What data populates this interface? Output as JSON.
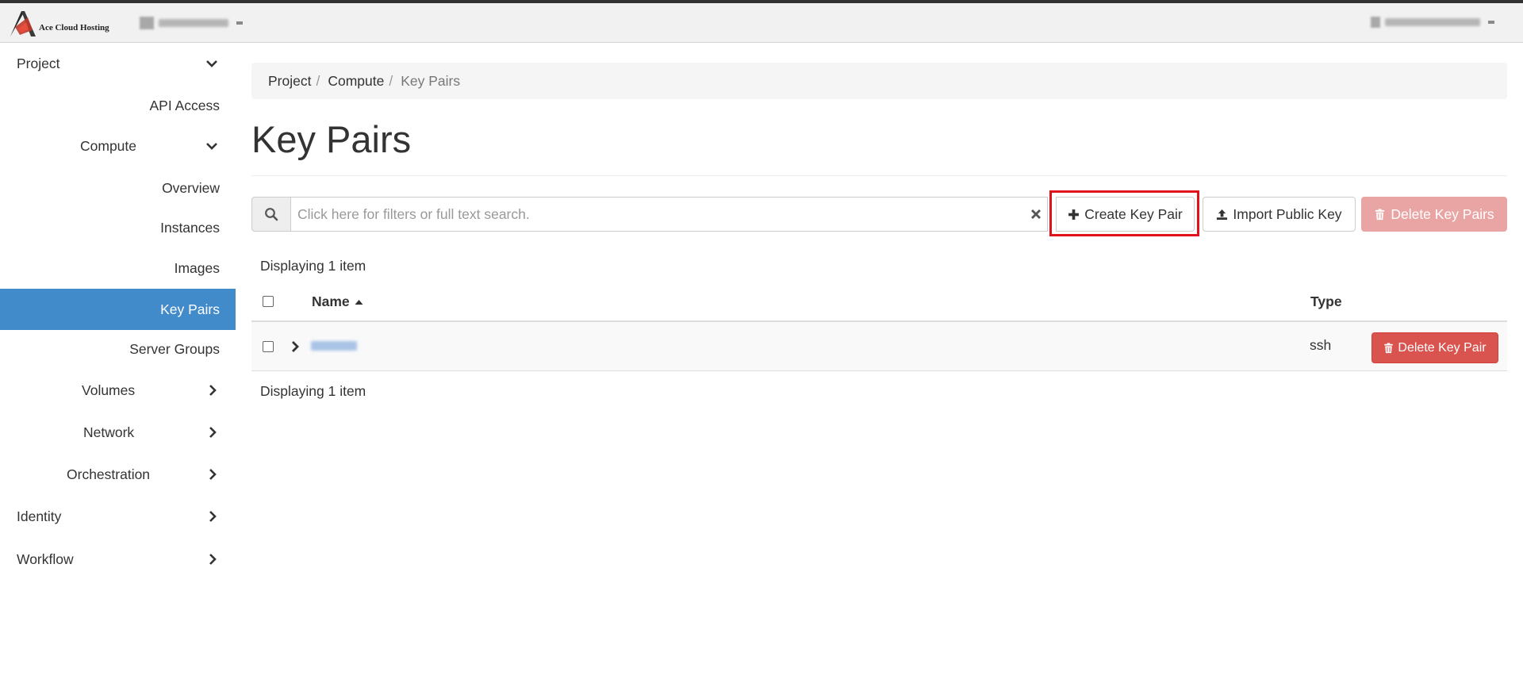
{
  "brand": {
    "name": "Ace Cloud Hosting",
    "logo_icon": "ace-logo-icon",
    "accent": "#c0392b"
  },
  "topbar": {
    "project_selector_icon": "folder-icon",
    "user_menu_icon": "user-icon"
  },
  "sidebar": {
    "project": {
      "label": "Project",
      "icon": "chevron-down-icon"
    },
    "api_access": {
      "label": "API Access"
    },
    "compute": {
      "label": "Compute",
      "icon": "chevron-down-icon"
    },
    "overview": {
      "label": "Overview"
    },
    "instances": {
      "label": "Instances"
    },
    "images": {
      "label": "Images"
    },
    "key_pairs": {
      "label": "Key Pairs",
      "active": true
    },
    "server_groups": {
      "label": "Server Groups"
    },
    "volumes": {
      "label": "Volumes",
      "icon": "chevron-right-icon"
    },
    "network": {
      "label": "Network",
      "icon": "chevron-right-icon"
    },
    "orchestration": {
      "label": "Orchestration",
      "icon": "chevron-right-icon"
    },
    "identity": {
      "label": "Identity",
      "icon": "chevron-right-icon"
    },
    "workflow": {
      "label": "Workflow",
      "icon": "chevron-right-icon"
    }
  },
  "breadcrumb": {
    "items": [
      "Project",
      "Compute",
      "Key Pairs"
    ],
    "separator": "/"
  },
  "page": {
    "title": "Key Pairs"
  },
  "search": {
    "placeholder": "Click here for filters or full text search.",
    "value": ""
  },
  "actions": {
    "create_label": "Create Key Pair",
    "import_label": "Import Public Key",
    "delete_all_label": "Delete Key Pairs",
    "highlight_color": "#e0121b"
  },
  "table": {
    "count_text": "Displaying 1 item",
    "columns": {
      "name": "Name",
      "type": "Type"
    },
    "sort": {
      "column": "name",
      "direction": "ascending"
    },
    "rows": [
      {
        "type": "ssh",
        "action_label": "Delete Key Pair"
      }
    ]
  },
  "colors": {
    "active_nav": "#428bca",
    "danger": "#d9534f",
    "danger_disabled": "#e9a5a3"
  }
}
